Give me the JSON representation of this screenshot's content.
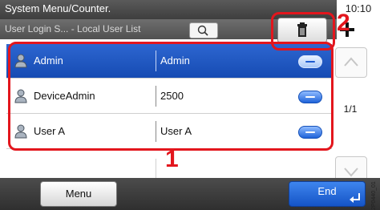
{
  "header": {
    "title": "System Menu/Counter.",
    "time": "10:10",
    "breadcrumb": "User Login S... - Local User List"
  },
  "icons": {
    "search": "search-icon",
    "delete": "trash-icon",
    "add": "plus-icon",
    "user": "user-icon",
    "detail": "detail-icon",
    "scroll_up": "chevron-up-icon",
    "scroll_down": "chevron-down-icon",
    "enter": "enter-icon"
  },
  "users": [
    {
      "name": "Admin",
      "login": "Admin",
      "selected": true
    },
    {
      "name": "DeviceAdmin",
      "login": "2500",
      "selected": false
    },
    {
      "name": "User A",
      "login": "User A",
      "selected": false
    }
  ],
  "pagination": {
    "label": "1/1"
  },
  "footer": {
    "menu_label": "Menu",
    "end_label": "End"
  },
  "annotations": {
    "callout_1": "1",
    "callout_2": "2"
  },
  "figure_code": "2P0440_01",
  "colors": {
    "accent_blue": "#1c5ad0",
    "annotation_red": "#e3161d",
    "header_gray": "#4a4a4a"
  }
}
